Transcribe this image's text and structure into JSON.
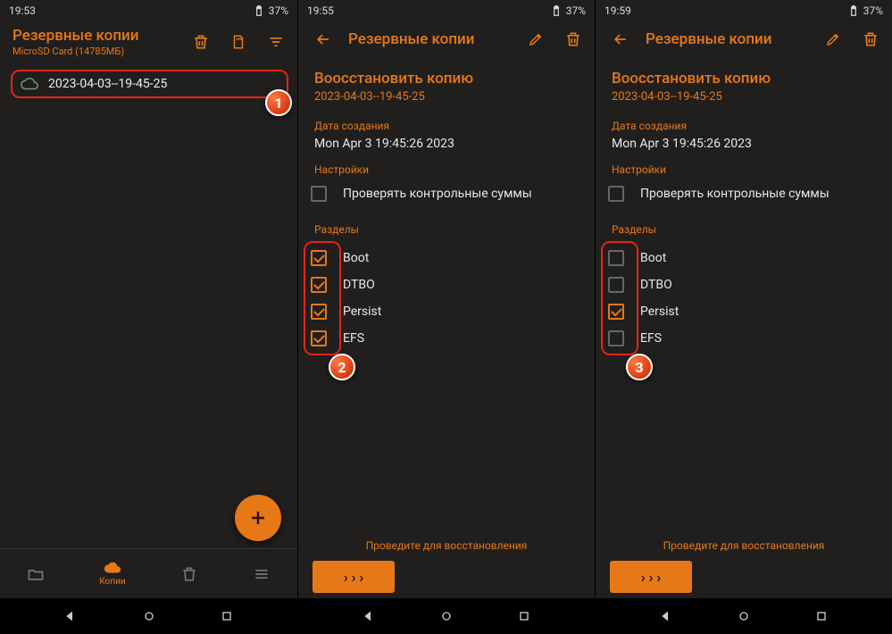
{
  "colors": {
    "accent": "#e77817",
    "bg": "#201f1e",
    "highlight": "#e32418"
  },
  "screen1": {
    "status": {
      "time": "19:53",
      "battery": "37%"
    },
    "header": {
      "title": "Резервные копии",
      "subtitle": "MicroSD Card (14785МБ)"
    },
    "backup_item": {
      "label": "2023-04-03--19-45-25"
    },
    "nav": {
      "copies_label": "Копии"
    },
    "badge": "1"
  },
  "screen2": {
    "status": {
      "time": "19:55",
      "battery": "37%"
    },
    "header": {
      "title": "Резервные копии"
    },
    "restore": {
      "title": "Воосстановить копию",
      "name": "2023-04-03--19-45-25",
      "created_label": "Дата создания",
      "created_value": "Mon Apr  3 19:45:26 2023",
      "settings_label": "Настройки",
      "verify_label": "Проверять контрольные суммы",
      "partitions_label": "Разделы",
      "partitions": [
        {
          "name": "Boot",
          "checked": true
        },
        {
          "name": "DTBO",
          "checked": true
        },
        {
          "name": "Persist",
          "checked": true
        },
        {
          "name": "EFS",
          "checked": true
        }
      ],
      "swipe_prompt": "Проведите для восстановления"
    },
    "badge": "2"
  },
  "screen3": {
    "status": {
      "time": "19:59",
      "battery": "37%"
    },
    "header": {
      "title": "Резервные копии"
    },
    "restore": {
      "title": "Воосстановить копию",
      "name": "2023-04-03--19-45-25",
      "created_label": "Дата создания",
      "created_value": "Mon Apr  3 19:45:26 2023",
      "settings_label": "Настройки",
      "verify_label": "Проверять контрольные суммы",
      "partitions_label": "Разделы",
      "partitions": [
        {
          "name": "Boot",
          "checked": false
        },
        {
          "name": "DTBO",
          "checked": false
        },
        {
          "name": "Persist",
          "checked": true
        },
        {
          "name": "EFS",
          "checked": false
        }
      ],
      "swipe_prompt": "Проведите для восстановления"
    },
    "badge": "3"
  }
}
